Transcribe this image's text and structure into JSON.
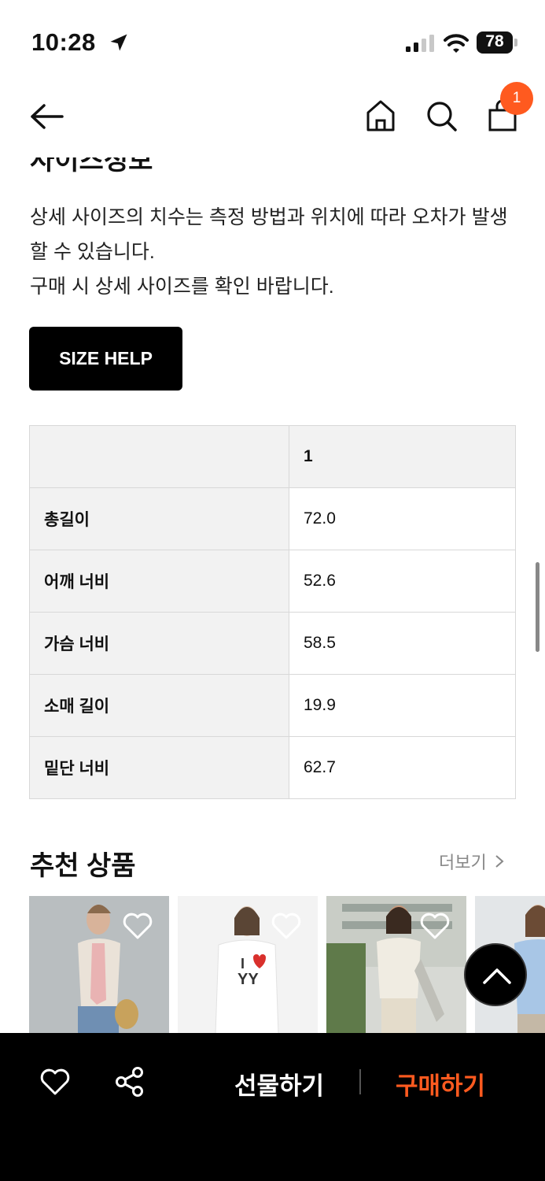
{
  "status_bar": {
    "time": "10:28",
    "battery": "78"
  },
  "header": {
    "cart_count": "1"
  },
  "size_section": {
    "title": "사이즈정보",
    "notice_lines": [
      "상세 사이즈의 치수는 측정 방법과 위치에 따라 오차가 발생할 수 있습니다.",
      "구매 시 상세 사이즈를 확인 바랍니다."
    ],
    "size_help_label": "SIZE HELP",
    "table": {
      "header": [
        "",
        "1"
      ],
      "rows": [
        {
          "label": "총길이",
          "value": "72.0"
        },
        {
          "label": "어깨 너비",
          "value": "52.6"
        },
        {
          "label": "가슴 너비",
          "value": "58.5"
        },
        {
          "label": "소매 길이",
          "value": "19.9"
        },
        {
          "label": "밑단 너비",
          "value": "62.7"
        }
      ]
    }
  },
  "recommend": {
    "title": "추천 상품",
    "more_label": "더보기",
    "products": [
      {
        "image": "model-in-beige-top"
      },
      {
        "image": "model-in-white-i-love-yy-tee"
      },
      {
        "image": "model-in-cream-henley"
      },
      {
        "image": "model-in-light-blue-tee"
      }
    ]
  },
  "bottom_bar": {
    "gift_label": "선물하기",
    "buy_label": "구매하기"
  },
  "colors": {
    "accent": "#ff5a1f",
    "bar": "#000000"
  }
}
